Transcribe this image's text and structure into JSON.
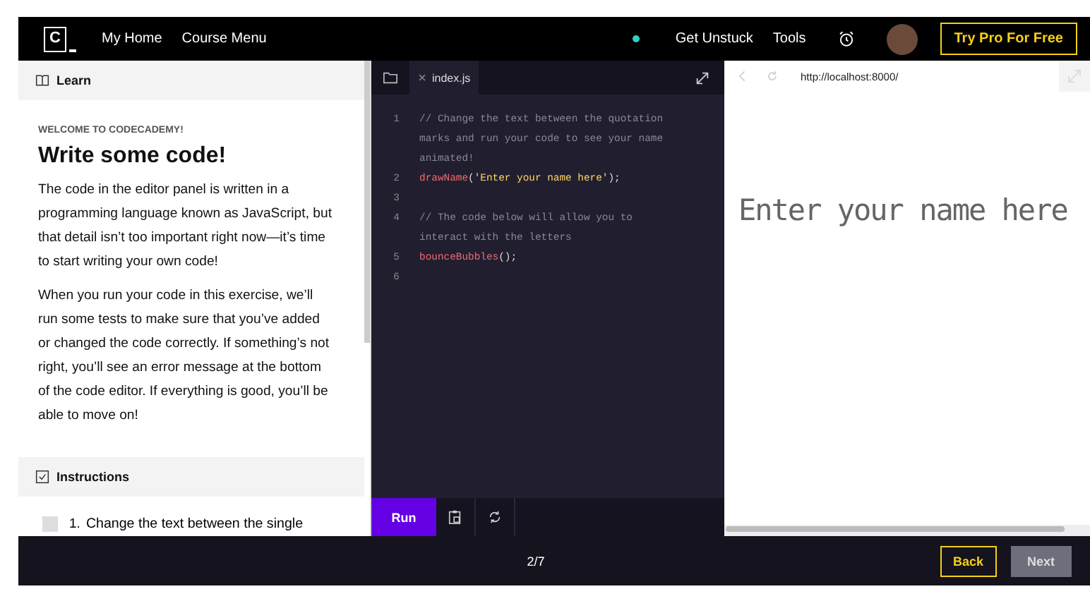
{
  "header": {
    "logo": "C",
    "nav": [
      "My Home",
      "Course Menu"
    ],
    "status_dot": {
      "color": "#2fd1c5"
    },
    "links": [
      "Get Unstuck",
      "Tools"
    ],
    "cta": "Try Pro For Free"
  },
  "learn": {
    "tab": "Learn",
    "eyebrow": "WELCOME TO CODECADEMY!",
    "title": "Write some code!",
    "paragraphs": [
      "The code in the editor panel is written in a programming language known as JavaScript, but that detail isn’t too important right now—it’s time to start writing your own code!",
      "When you run your code in this exercise, we’ll run some tests to make sure that you’ve added or changed the code correctly. If something’s not right, you’ll see an error message at the bottom of the code editor. If everything is good, you’ll be able to move on!"
    ]
  },
  "instructions": {
    "title": "Instructions",
    "items": [
      {
        "number": "1.",
        "text": "Change the text between the single",
        "checked": false
      }
    ]
  },
  "editor": {
    "file_tab": "index.js",
    "lines": [
      {
        "number": "1",
        "segments": [
          {
            "kind": "comment",
            "text": "// Change the text between the quotation marks and run your code to see your name animated!"
          }
        ]
      },
      {
        "number": "2",
        "segments": [
          {
            "kind": "function",
            "text": "drawName"
          },
          {
            "kind": "punct",
            "text": "("
          },
          {
            "kind": "string",
            "text": "'Enter your name here'"
          },
          {
            "kind": "punct",
            "text": ");"
          }
        ]
      },
      {
        "number": "3"
      },
      {
        "number": "4",
        "segments": [
          {
            "kind": "comment",
            "text": "// The code below will allow you to interact with the letters"
          }
        ]
      },
      {
        "number": "5",
        "segments": [
          {
            "kind": "function",
            "text": "bounceBubbles"
          },
          {
            "kind": "punct",
            "text": "();"
          }
        ]
      },
      {
        "number": "6"
      }
    ],
    "run_button": "Run"
  },
  "browser": {
    "url": "http://localhost:8000/",
    "output_text": "Enter your name here"
  },
  "footer": {
    "progress": "2/7",
    "back": "Back",
    "next": {
      "label": "Next",
      "disabled": true
    }
  }
}
